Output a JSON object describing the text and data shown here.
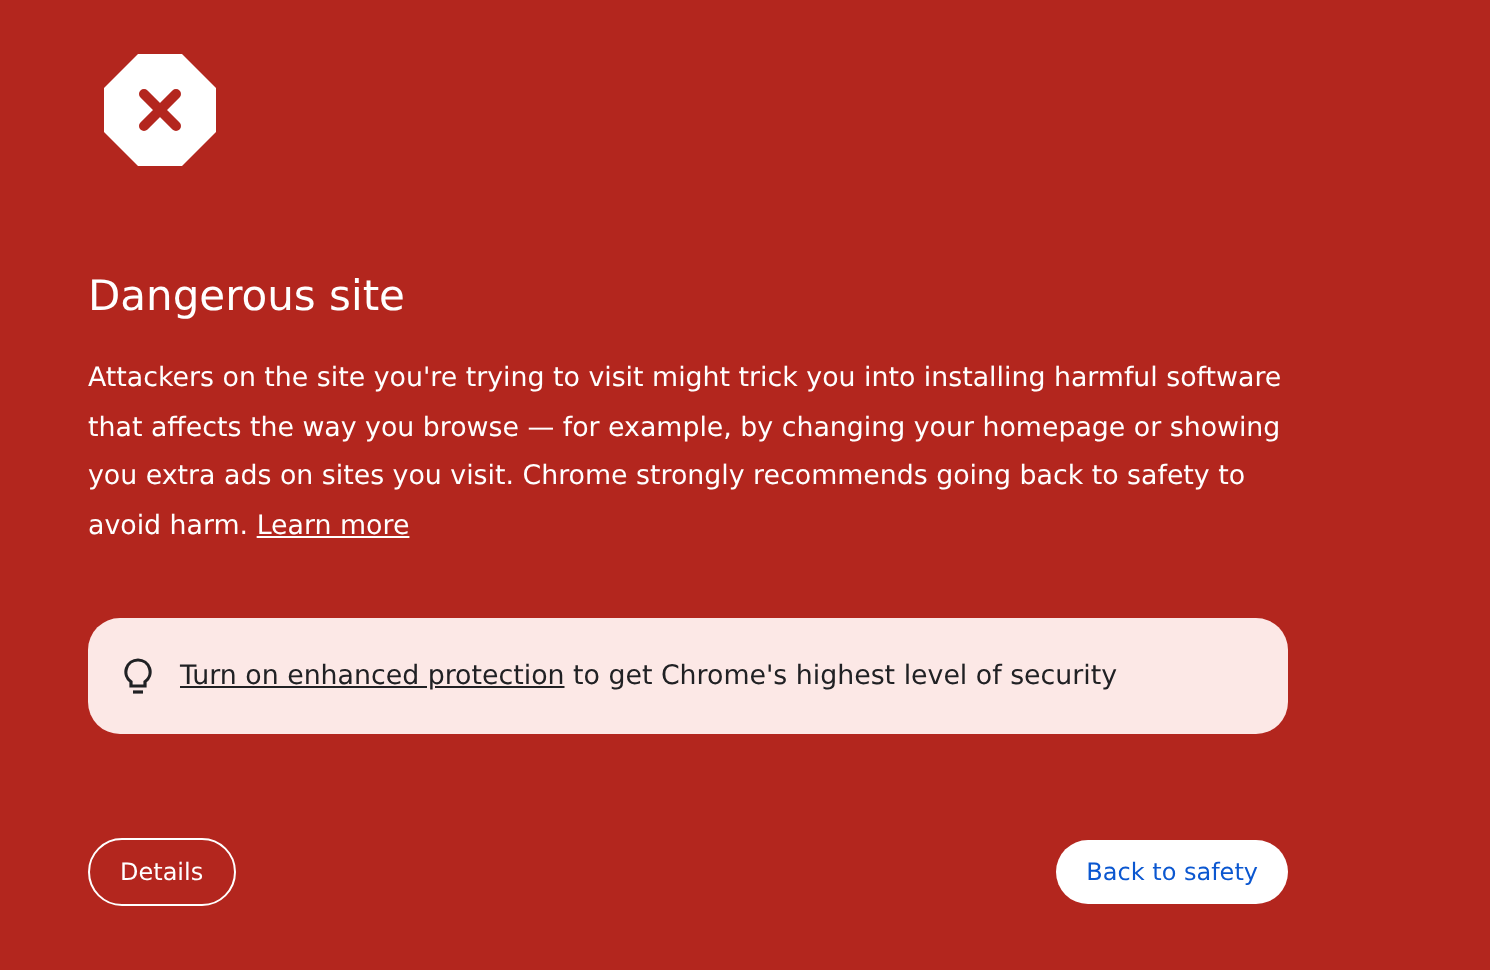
{
  "heading": "Dangerous site",
  "description": {
    "text": "Attackers on the site you're trying to visit might trick you into installing harmful software that affects the way you browse — for example, by changing your homepage or showing you extra ads on sites you visit. Chrome strongly recommends going back to safety to avoid harm.",
    "link": "Learn more"
  },
  "tip": {
    "link": "Turn on enhanced protection",
    "text": "to get Chrome's highest level of security"
  },
  "buttons": [
    {
      "label": "Details",
      "kind": "secondary"
    },
    {
      "label": "Back to safety",
      "kind": "primary"
    }
  ]
}
